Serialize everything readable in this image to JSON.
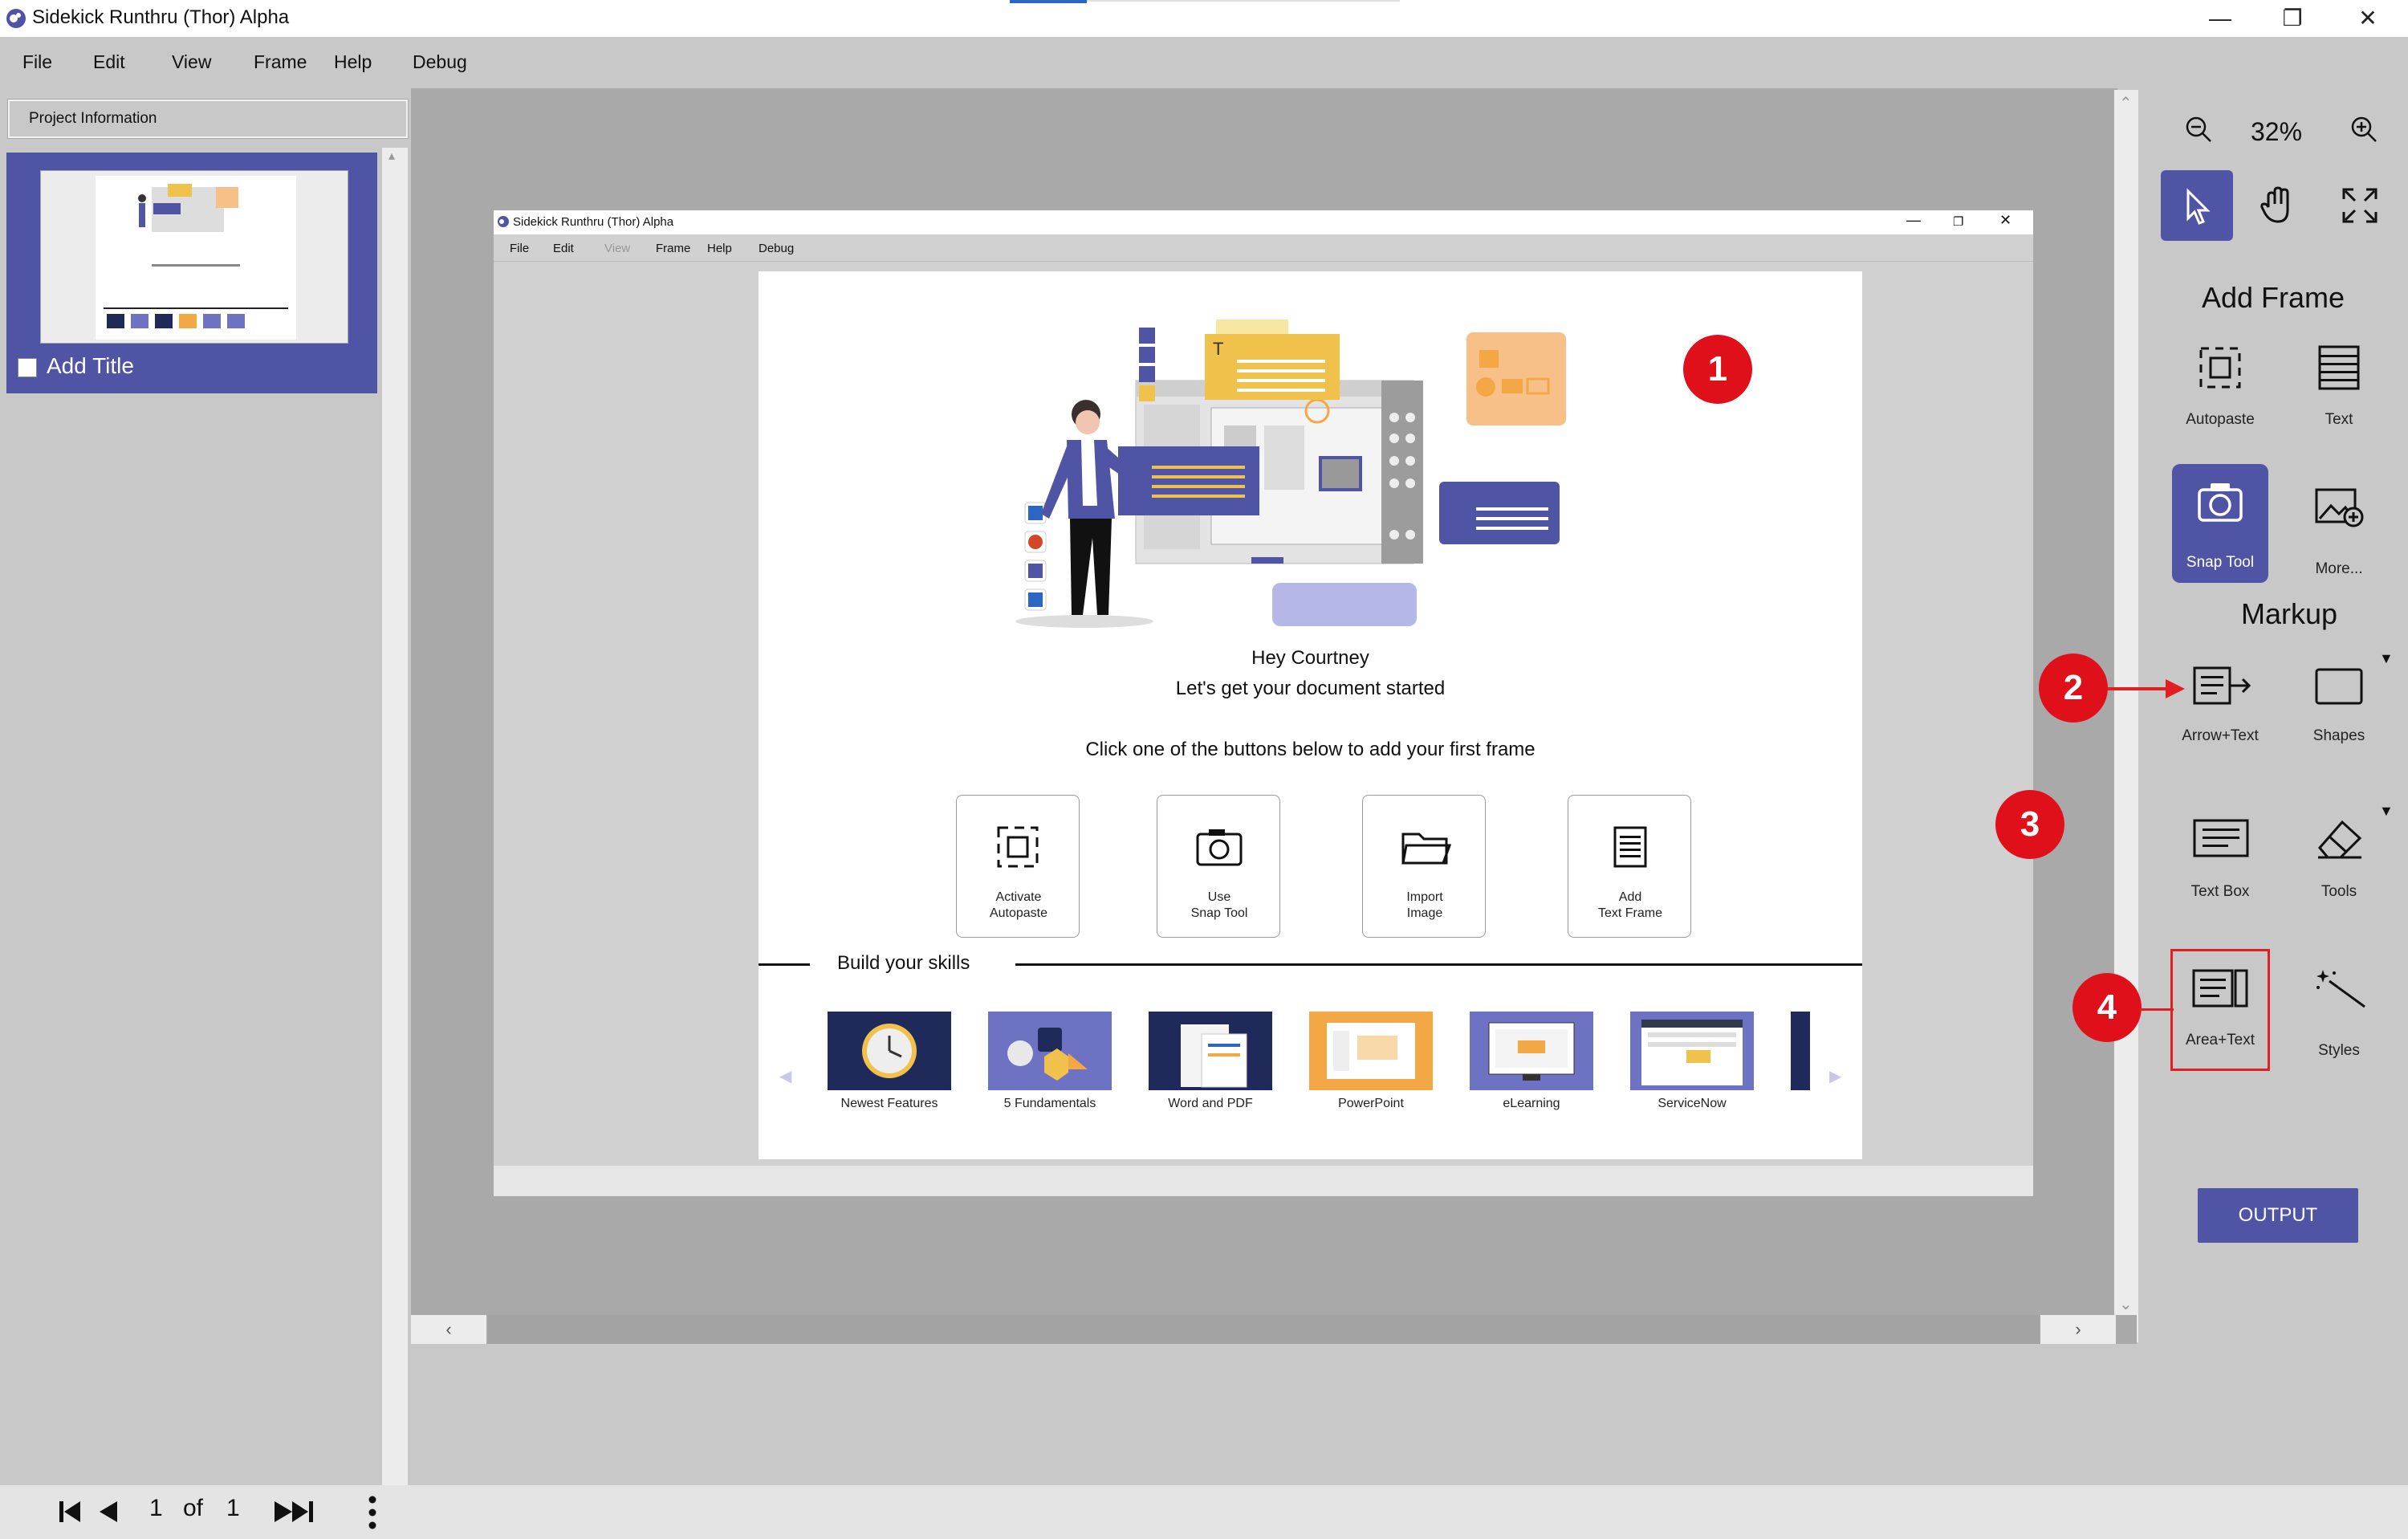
{
  "app": {
    "title": "Sidekick Runthru (Thor) Alpha",
    "window_controls": {
      "minimize": "—",
      "restore": "❐",
      "close": "✕"
    }
  },
  "menu": [
    "File",
    "Edit",
    "View",
    "Frame",
    "Help",
    "Debug"
  ],
  "left_panel": {
    "project_info": "Project Information",
    "frame_title": "Add Title"
  },
  "inner_window": {
    "title": "Sidekick Runthru (Thor) Alpha",
    "menu": [
      "File",
      "Edit",
      "View",
      "Frame",
      "Help",
      "Debug"
    ],
    "greeting": "Hey Courtney",
    "subtitle": "Let's get your document started",
    "instruction": "Click one of the buttons below to add your first frame",
    "tiles": [
      {
        "line1": "Activate",
        "line2": "Autopaste",
        "icon": "autopaste-icon"
      },
      {
        "line1": "Use",
        "line2": "Snap Tool",
        "icon": "camera-icon"
      },
      {
        "line1": "Import",
        "line2": "Image",
        "icon": "folder-icon"
      },
      {
        "line1": "Add",
        "line2": "Text Frame",
        "icon": "text-frame-icon"
      }
    ],
    "skills_title": "Build your skills",
    "courses": [
      "Newest Features",
      "5 Fundamentals",
      "Word and PDF",
      "PowerPoint",
      "eLearning",
      "ServiceNow"
    ],
    "nav_prev": "◀",
    "nav_next": "▶"
  },
  "right_panel": {
    "zoom": "32%",
    "add_frame_title": "Add Frame",
    "add_frame": [
      {
        "label": "Autopaste",
        "icon": "autopaste-icon"
      },
      {
        "label": "Text",
        "icon": "text-icon"
      },
      {
        "label": "Snap Tool",
        "icon": "camera-icon"
      },
      {
        "label": "More...",
        "icon": "image-add-icon"
      }
    ],
    "markup_title": "Markup",
    "markup": [
      {
        "label": "Arrow+Text",
        "icon": "arrow-text-icon"
      },
      {
        "label": "Shapes",
        "icon": "rectangle-icon"
      },
      {
        "label": "Text Box",
        "icon": "text-box-icon"
      },
      {
        "label": "Tools",
        "icon": "eraser-icon"
      },
      {
        "label": "Area+Text",
        "icon": "area-text-icon"
      },
      {
        "label": "Styles",
        "icon": "magic-wand-icon"
      }
    ],
    "output": "OUTPUT"
  },
  "pager": {
    "current": "1",
    "of": "of",
    "total": "1"
  },
  "annotations": [
    "1",
    "2",
    "3",
    "4"
  ],
  "colors": {
    "accent": "#5054a4",
    "badge": "#e0101a",
    "canvas": "#a9a9a9"
  }
}
